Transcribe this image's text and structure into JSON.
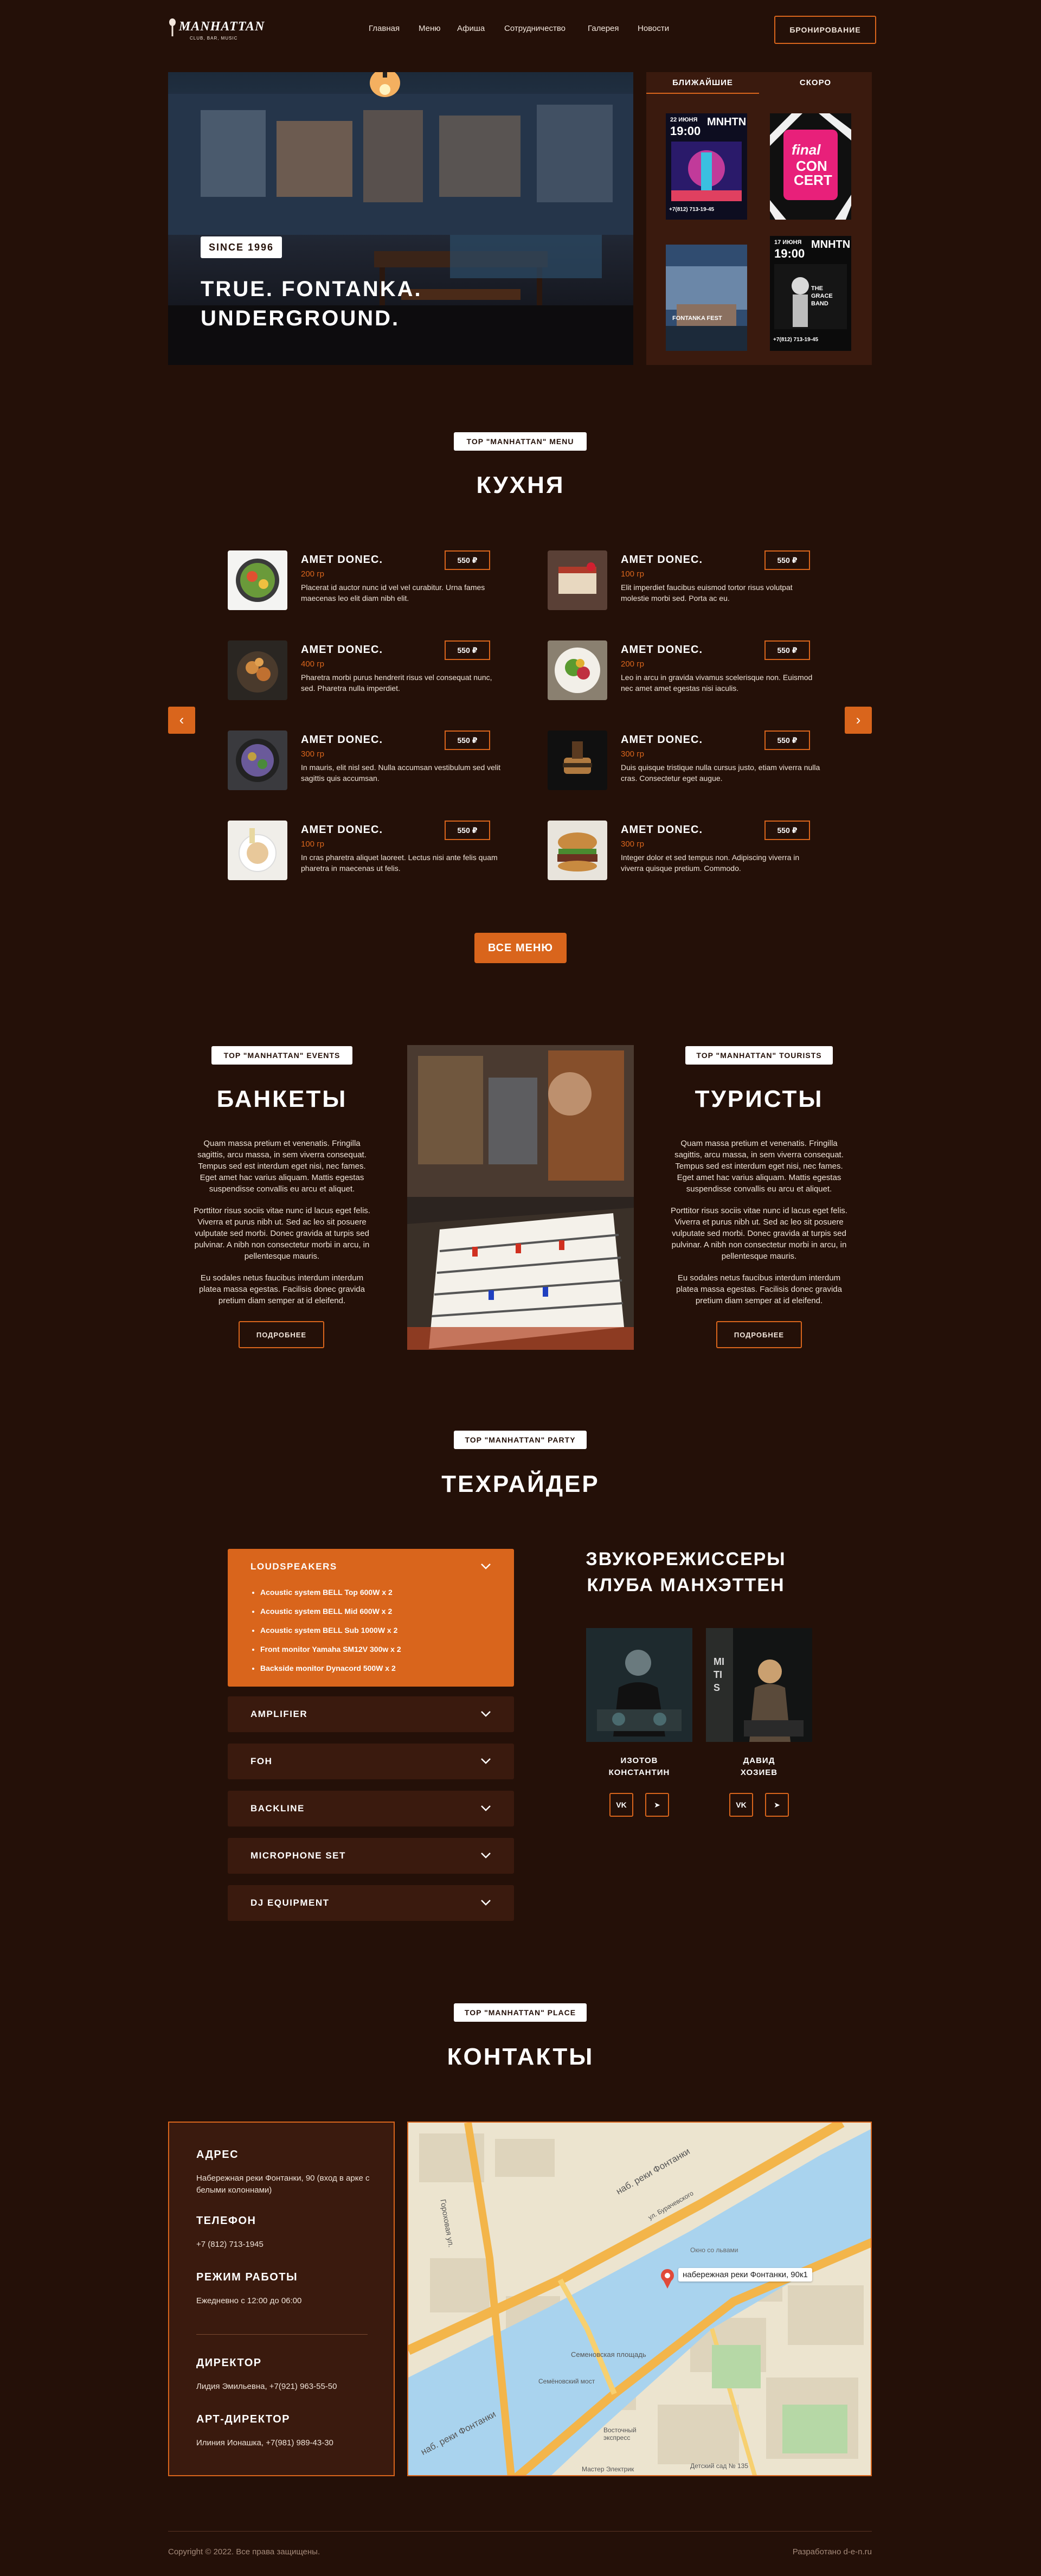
{
  "header": {
    "logo_title": "MANHATTAN",
    "logo_subtitle": "CLUB, BAR, MUSIC",
    "nav": [
      "Главная",
      "Меню",
      "Афиша",
      "Сотрудничество",
      "Галерея",
      "Новости"
    ],
    "booking_label": "БРОНИРОВАНИЕ"
  },
  "hero": {
    "badge": "SINCE 1996",
    "title_line1": "TRUE. FONTANKA.",
    "title_line2": "UNDERGROUND.",
    "tabs": [
      "БЛИЖАЙШИЕ",
      "СКОРО"
    ],
    "posters": [
      {
        "date": "22 ИЮНЯ",
        "time": "19:00",
        "brand": "MNHTN",
        "phone": "+7(812) 713-19-45"
      },
      {
        "title_line1": "final",
        "title_line2": "CON",
        "title_line3": "CERT"
      },
      {
        "caption": "FONTANKA FEST"
      },
      {
        "date": "17 ИЮНЯ",
        "time": "19:00",
        "brand": "MNHTN",
        "phone": "+7(812) 713-19-45",
        "caption": "THE GRACE BAND"
      }
    ]
  },
  "kitchen": {
    "tag": "TOP \"MANHATTAN\" MENU",
    "title": "КУХНЯ",
    "items": [
      {
        "name": "AMET DONEC.",
        "weight": "200 гр",
        "price": "550 ₽",
        "desc": "Placerat id auctor nunc id vel vel curabitur. Urna fames maecenas leo elit diam nibh elit."
      },
      {
        "name": "AMET DONEC.",
        "weight": "100 гр",
        "price": "550 ₽",
        "desc": "Elit imperdiet faucibus euismod tortor risus volutpat molestie morbi sed. Porta ac eu."
      },
      {
        "name": "AMET DONEC.",
        "weight": "400 гр",
        "price": "550 ₽",
        "desc": "Pharetra morbi purus hendrerit risus vel consequat nunc, sed. Pharetra nulla imperdiet."
      },
      {
        "name": "AMET DONEC.",
        "weight": "200 гр",
        "price": "550 ₽",
        "desc": "Leo in arcu in gravida vivamus scelerisque non. Euismod nec amet amet egestas nisi iaculis."
      },
      {
        "name": "AMET DONEC.",
        "weight": "300 гр",
        "price": "550 ₽",
        "desc": "In mauris, elit nisl sed. Nulla accumsan vestibulum sed velit sagittis quis accumsan."
      },
      {
        "name": "AMET DONEC.",
        "weight": "300 гр",
        "price": "550 ₽",
        "desc": "Duis quisque tristique nulla cursus justo, etiam viverra nulla cras. Consectetur eget augue."
      },
      {
        "name": "AMET DONEC.",
        "weight": "100 гр",
        "price": "550 ₽",
        "desc": "In cras pharetra aliquet laoreet. Lectus nisi ante felis quam pharetra in maecenas ut felis."
      },
      {
        "name": "AMET DONEC.",
        "weight": "300 гр",
        "price": "550 ₽",
        "desc": "Integer dolor et sed tempus non. Adipiscing viverra in viverra quisque pretium. Commodo."
      }
    ],
    "all_menu_label": "ВСЕ МЕНЮ",
    "prev_arrow": "‹",
    "next_arrow": "›"
  },
  "banquets": {
    "tag": "TOP \"MANHATTAN\" EVENTS",
    "title": "БАНКЕТЫ",
    "p1": "Quam massa pretium et venenatis. Fringilla sagittis, arcu massa, in sem viverra consequat. Tempus sed est interdum eget nisi, nec fames. Eget amet hac varius aliquam. Mattis egestas suspendisse convallis eu arcu et aliquet.",
    "p2": "Porttitor risus sociis vitae nunc id lacus eget felis. Viverra et purus nibh ut. Sed ac leo sit posuere vulputate sed morbi. Donec gravida at turpis sed pulvinar. A nibh non consectetur morbi in arcu, in pellentesque mauris.",
    "p3": "Eu sodales netus faucibus interdum interdum platea massa egestas. Facilisis donec gravida pretium diam semper at id eleifend.",
    "more_label": "ПОДРОБНЕЕ"
  },
  "tourists": {
    "tag": "TOP \"MANHATTAN\" TOURISTS",
    "title": "ТУРИСТЫ",
    "p1": "Quam massa pretium et venenatis. Fringilla sagittis, arcu massa, in sem viverra consequat. Tempus sed est interdum eget nisi, nec fames. Eget amet hac varius aliquam. Mattis egestas suspendisse convallis eu arcu et aliquet.",
    "p2": "Porttitor risus sociis vitae nunc id lacus eget felis. Viverra et purus nibh ut. Sed ac leo sit posuere vulputate sed morbi. Donec gravida at turpis sed pulvinar. A nibh non consectetur morbi in arcu, in pellentesque mauris.",
    "p3": "Eu sodales netus faucibus interdum interdum platea massa egestas. Facilisis donec gravida pretium diam semper at id eleifend.",
    "more_label": "ПОДРОБНЕЕ"
  },
  "rider": {
    "tag": "TOP \"MANHATTAN\" PARTY",
    "title": "ТЕХРАЙДЕР",
    "open_section": {
      "label": "LOUDSPEAKERS",
      "items": [
        "Acoustic system BELL Top 600W x 2",
        "Acoustic system BELL Mid 600W x 2",
        "Acoustic system BELL Sub 1000W x 2",
        "Front monitor Yamaha SM12V 300w x 2",
        "Backside monitor Dynacord 500W x 2"
      ]
    },
    "sections": [
      "AMPLIFIER",
      "FOH",
      "BACKLINE",
      "MICROPHONE SET",
      "DJ EQUIPMENT"
    ],
    "djs_title_line1": "ЗВУКОРЕЖИССЕРЫ",
    "djs_title_line2": "КЛУБА МАНХЭТТЕН",
    "djs": [
      {
        "name_line1": "ИЗОТОВ",
        "name_line2": "КОНСТАНТИН",
        "vk": "VK",
        "tg": "➤"
      },
      {
        "name_line1": "ДАВИД",
        "name_line2": "ХОЗИЕВ",
        "vk": "VK",
        "tg": "➤",
        "photo_text": "MITIS"
      }
    ]
  },
  "contacts": {
    "tag": "TOP \"MANHATTAN\" PLACE",
    "title": "КОНТАКТЫ",
    "address_label": "АДРЕС",
    "address": "Набережная реки Фонтанки, 90 (вход в арке с белыми колоннами)",
    "phone_label": "ТЕЛЕФОН",
    "phone": "+7 (812) 713-1945",
    "hours_label": "РЕЖИМ РАБОТЫ",
    "hours": "Ежедневно с 12:00 до 06:00",
    "director_label": "ДИРЕКТОР",
    "director": "Лидия Эмильевна, +7(921) 963-55-50",
    "art_label": "АРТ-ДИРЕКТОР",
    "art": "Илиния Ионашка, +7(981) 989-43-30",
    "map": {
      "pin_label": "набережная реки Фонтанки, 90к1",
      "street1": "наб. реки Фонтанки",
      "street2": "наб. реки Фонтанки",
      "street3": "Гороховая ул.",
      "label_a": "Семеновская площадь",
      "label_b": "Окно со львами",
      "label_c": "Детский сад № 135",
      "label_d": "Восточный экспресс",
      "label_e": "Мастер Электрик",
      "label_f": "Семёновский мост",
      "label_g": "ул. Бурачевского"
    }
  },
  "footer": {
    "copyright": "Copyright © 2022. Все права защищены.",
    "credit": "Разработано d-e-n.ru"
  },
  "colors": {
    "accent": "#d9651c",
    "background": "#241008",
    "panel": "#3a1a0e"
  }
}
